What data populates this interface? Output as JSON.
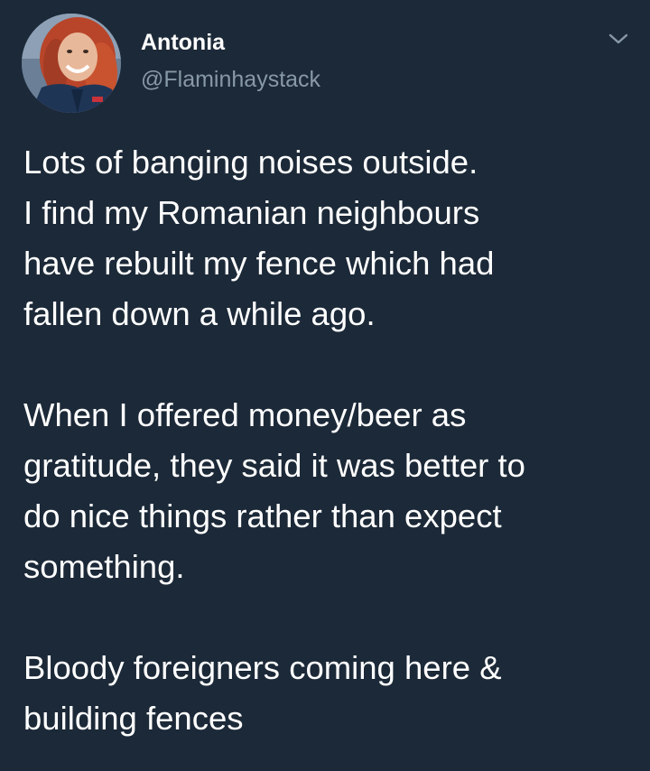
{
  "author": {
    "display_name": "Antonia",
    "handle": "@Flaminhaystack",
    "avatar_icon": "profile-photo-icon"
  },
  "menu": {
    "icon": "chevron-down-icon"
  },
  "tweet": {
    "paragraphs": [
      "Lots of banging noises outside.\nI find my Romanian neighbours\nhave rebuilt my fence which had\nfallen down a while ago.",
      "When I offered money/beer as\ngratitude, they said it was better to\ndo nice things rather than expect\nsomething.",
      "Bloody foreigners coming here &\nbuilding fences"
    ]
  },
  "colors": {
    "background": "#1c2938",
    "primary_text": "#ffffff",
    "secondary_text": "#8899a6"
  }
}
